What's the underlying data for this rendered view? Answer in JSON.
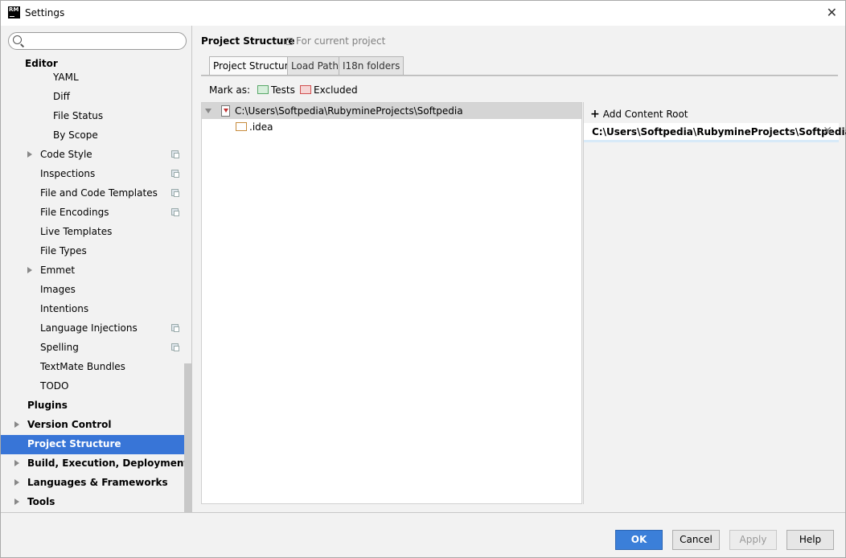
{
  "window": {
    "title": "Settings",
    "icon_text": "RM"
  },
  "search": {
    "placeholder": ""
  },
  "sidebar": {
    "editor_label": "Editor",
    "editor_children": [
      {
        "label": "YAML",
        "indent": 2,
        "arrow": false,
        "copy": false
      },
      {
        "label": "Diff",
        "indent": 2,
        "arrow": false,
        "copy": false
      },
      {
        "label": "File Status",
        "indent": 2,
        "arrow": false,
        "copy": false
      },
      {
        "label": "By Scope",
        "indent": 2,
        "arrow": false,
        "copy": false
      },
      {
        "label": "Code Style",
        "indent": 1,
        "arrow": true,
        "copy": true
      },
      {
        "label": "Inspections",
        "indent": 1,
        "arrow": false,
        "copy": true
      },
      {
        "label": "File and Code Templates",
        "indent": 1,
        "arrow": false,
        "copy": true
      },
      {
        "label": "File Encodings",
        "indent": 1,
        "arrow": false,
        "copy": true
      },
      {
        "label": "Live Templates",
        "indent": 1,
        "arrow": false,
        "copy": false
      },
      {
        "label": "File Types",
        "indent": 1,
        "arrow": false,
        "copy": false
      },
      {
        "label": "Emmet",
        "indent": 1,
        "arrow": true,
        "copy": false
      },
      {
        "label": "Images",
        "indent": 1,
        "arrow": false,
        "copy": false
      },
      {
        "label": "Intentions",
        "indent": 1,
        "arrow": false,
        "copy": false
      },
      {
        "label": "Language Injections",
        "indent": 1,
        "arrow": false,
        "copy": true
      },
      {
        "label": "Spelling",
        "indent": 1,
        "arrow": false,
        "copy": true
      },
      {
        "label": "TextMate Bundles",
        "indent": 1,
        "arrow": false,
        "copy": false
      },
      {
        "label": "TODO",
        "indent": 1,
        "arrow": false,
        "copy": false
      }
    ],
    "top_items": [
      {
        "label": "Plugins",
        "arrow": false,
        "selected": false
      },
      {
        "label": "Version Control",
        "arrow": true,
        "selected": false
      },
      {
        "label": "Project Structure",
        "arrow": false,
        "selected": true
      },
      {
        "label": "Build, Execution, Deployment",
        "arrow": true,
        "selected": false
      },
      {
        "label": "Languages & Frameworks",
        "arrow": true,
        "selected": false
      },
      {
        "label": "Tools",
        "arrow": true,
        "selected": false
      }
    ]
  },
  "main": {
    "title": "Project Structure",
    "subtitle": "For current project",
    "tabs": [
      "Project Structure",
      "Load Path",
      "I18n folders"
    ],
    "mark_as_label": "Mark as:",
    "mark_tests": "Tests",
    "mark_excluded": "Excluded",
    "root_path": "C:\\Users\\Softpedia\\RubymineProjects\\Softpedia",
    "child_folder": ".idea",
    "add_content_root": "Add Content Root",
    "content_root_path": "C:\\Users\\Softpedia\\RubymineProjects\\Softpedia"
  },
  "buttons": {
    "ok": "OK",
    "cancel": "Cancel",
    "apply": "Apply",
    "help": "Help"
  },
  "colors": {
    "selection": "#3875d7",
    "ok_button": "#3b7fd9"
  }
}
